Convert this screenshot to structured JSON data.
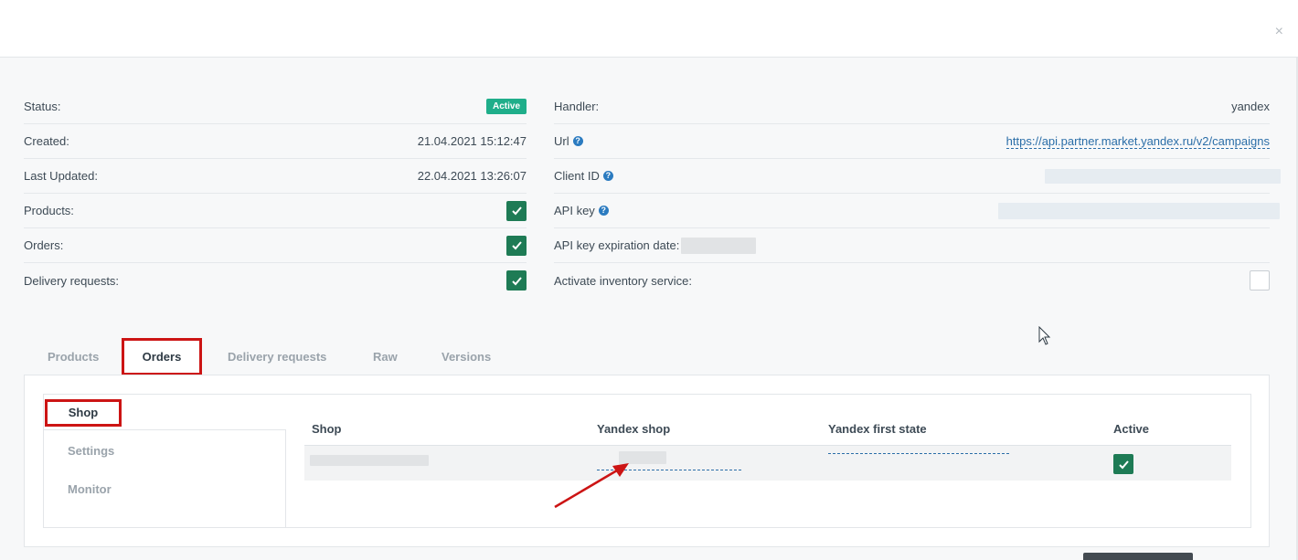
{
  "header": {
    "close_symbol": "×"
  },
  "left_info": [
    {
      "label": "Status:",
      "type": "badge",
      "value": "Active"
    },
    {
      "label": "Created:",
      "type": "text",
      "value": "21.04.2021 15:12:47"
    },
    {
      "label": "Last Updated:",
      "type": "text",
      "value": "22.04.2021 13:26:07"
    },
    {
      "label": "Products:",
      "type": "check",
      "checked": true
    },
    {
      "label": "Orders:",
      "type": "check",
      "checked": true
    },
    {
      "label": "Delivery requests:",
      "type": "check",
      "checked": true
    }
  ],
  "right_info": [
    {
      "label": "Handler:",
      "type": "text",
      "value": "yandex"
    },
    {
      "label": "Url",
      "help": true,
      "type": "link",
      "value": "https://api.partner.market.yandex.ru/v2/campaigns"
    },
    {
      "label": "Client ID",
      "help": true,
      "type": "redacted"
    },
    {
      "label": "API key",
      "help": true,
      "type": "redacted"
    },
    {
      "label": "API key expiration date:",
      "type": "redacted-inline"
    },
    {
      "label": "Activate inventory service:",
      "type": "checkbox-empty",
      "checked": false
    }
  ],
  "tabs": [
    "Products",
    "Orders",
    "Delivery requests",
    "Raw",
    "Versions"
  ],
  "active_tab": "Orders",
  "side_nav": [
    "Shop",
    "Settings",
    "Monitor"
  ],
  "active_side": "Shop",
  "table": {
    "columns": [
      "Shop",
      "Yandex shop",
      "Yandex first state",
      "Active"
    ],
    "rows": [
      {
        "shop": "",
        "yandex_shop": "",
        "yandex_first_state": "",
        "active": true
      }
    ]
  },
  "colors": {
    "accent_green": "#1e7b55",
    "badge_green": "#1fae8a",
    "highlight_red": "#cc1414",
    "link_blue": "#2b6ea8"
  }
}
